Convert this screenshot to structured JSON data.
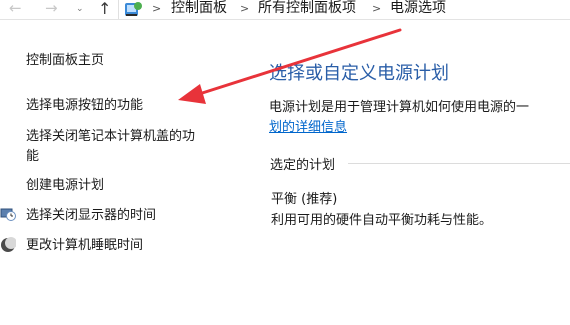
{
  "addressbar": {
    "back_glyph": "←",
    "forward_glyph": "→",
    "dropdown_glyph": "⌄",
    "up_glyph": "↑",
    "crumbs": [
      "控制面板",
      "所有控制面板项",
      "电源选项"
    ],
    "crumb_sep": ">"
  },
  "sidebar": {
    "home": "控制面板主页",
    "items": [
      {
        "label": "选择电源按钮的功能"
      },
      {
        "label_line1": "选择关闭笔记本计算机盖的功",
        "label_line2": "能"
      },
      {
        "label": "创建电源计划"
      },
      {
        "label": "选择关闭显示器的时间",
        "icon": "monitor-clock-icon"
      },
      {
        "label": "更改计算机睡眠时间",
        "icon": "moon-icon"
      }
    ]
  },
  "main": {
    "title": "选择或自定义电源计划",
    "description": "电源计划是用于管理计算机如何使用电源的一",
    "link": "划的详细信息",
    "section_label": "选定的计划",
    "plan_name": "平衡 (推荐)",
    "plan_description": "利用可用的硬件自动平衡功耗与性能。"
  },
  "annotation": {
    "color": "#e8333a"
  }
}
